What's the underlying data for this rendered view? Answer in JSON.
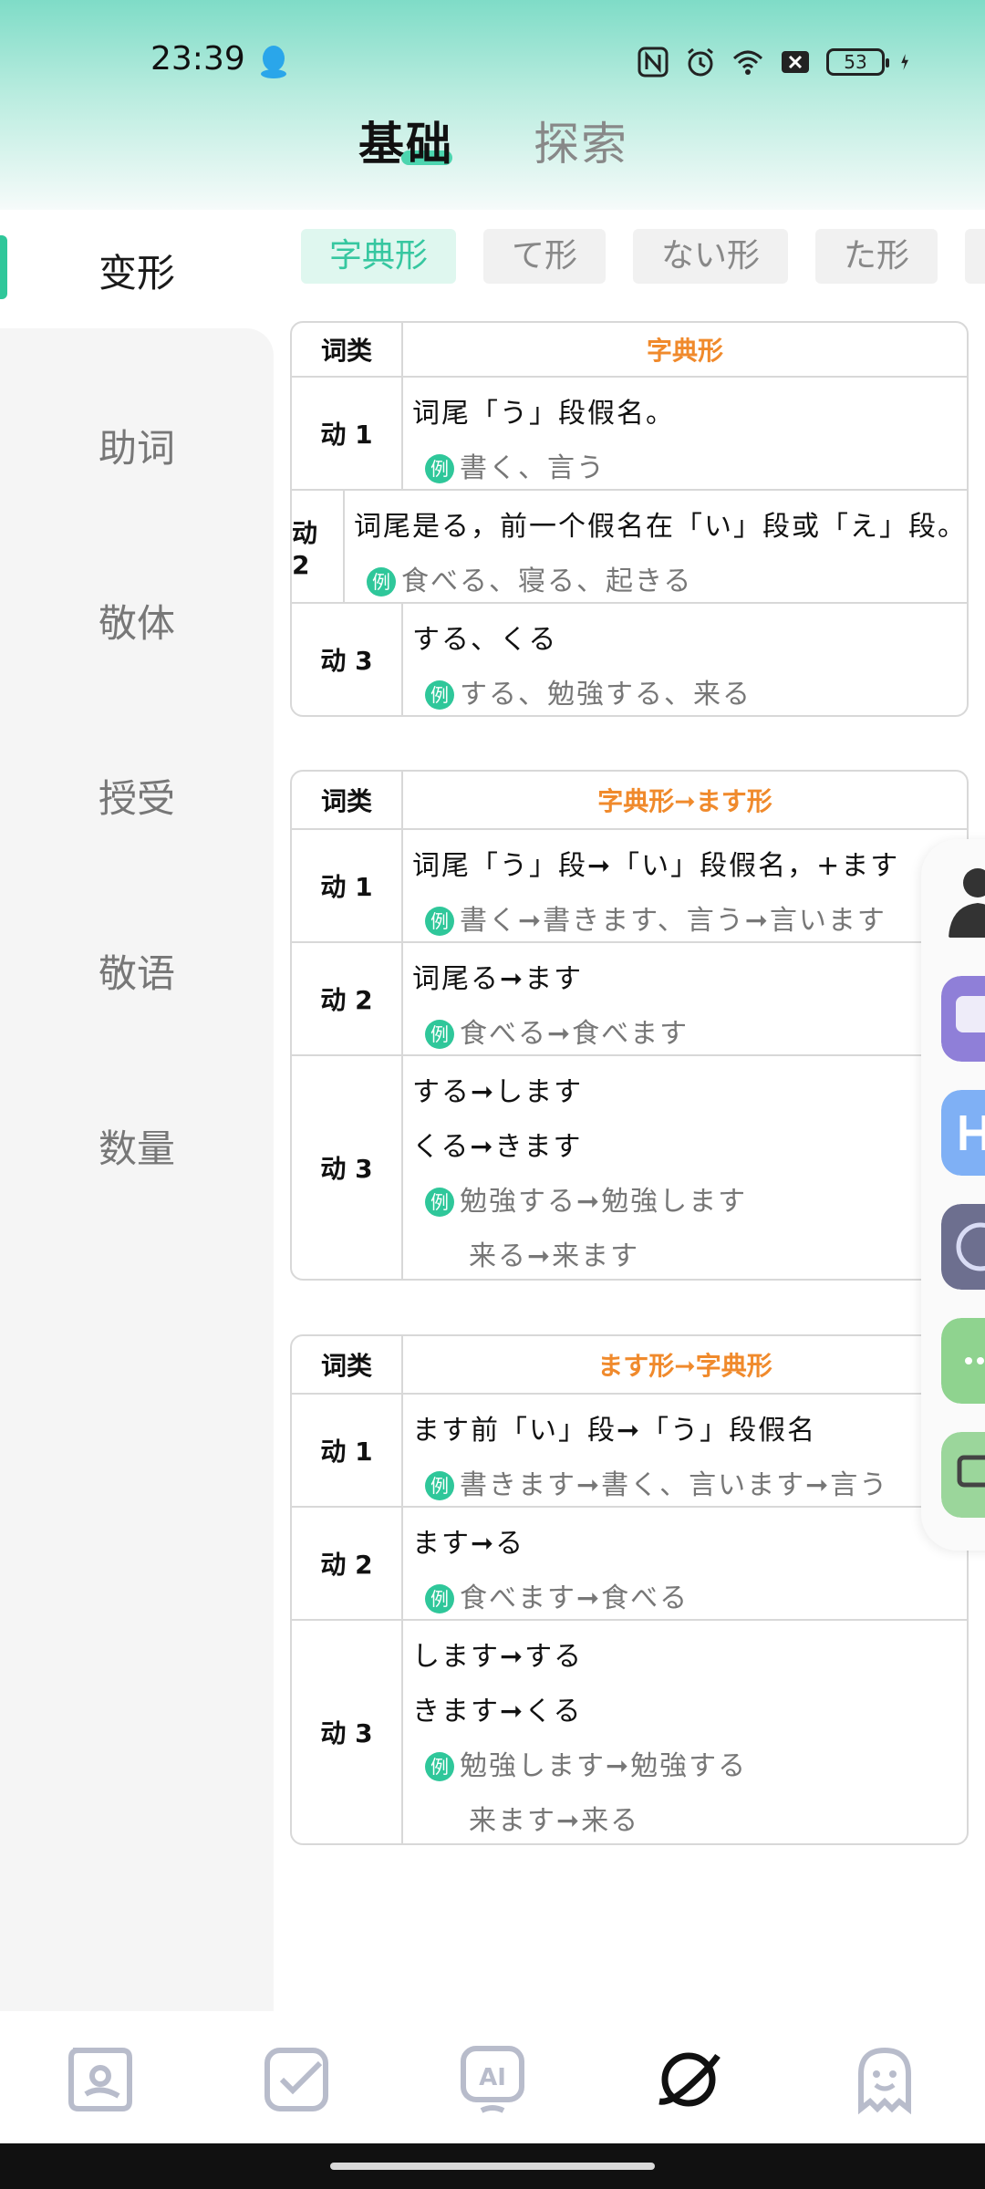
{
  "status_bar": {
    "time": "23:39",
    "battery": "53"
  },
  "top_tabs": {
    "basic": "基础",
    "explore": "探索"
  },
  "sidebar": {
    "items": [
      {
        "label": "变形",
        "active": true
      },
      {
        "label": "助词"
      },
      {
        "label": "敬体"
      },
      {
        "label": "授受"
      },
      {
        "label": "敬语"
      },
      {
        "label": "数量"
      }
    ]
  },
  "sub_tabs": [
    "字典形",
    "て形",
    "ない形",
    "た形"
  ],
  "example_badge": "例",
  "tables": [
    {
      "header": {
        "col1": "词类",
        "col2": "字典形"
      },
      "rows": [
        {
          "type": "动 1",
          "lines": [
            "词尾「う」段假名。"
          ],
          "examples": [
            "書く、言う"
          ]
        },
        {
          "type": "动 2",
          "lines": [
            "词尾是る，前一个假名在「い」段或「え」段。"
          ],
          "examples": [
            "食べる、寝る、起きる"
          ]
        },
        {
          "type": "动 3",
          "lines": [
            "する、くる"
          ],
          "examples": [
            "する、勉強する、来る"
          ]
        }
      ]
    },
    {
      "header": {
        "col1": "词类",
        "col2": "字典形➞ます形"
      },
      "rows": [
        {
          "type": "动 1",
          "lines": [
            "词尾「う」段➞「い」段假名，+ます"
          ],
          "examples": [
            "書く➞書きます、言う➞言います"
          ]
        },
        {
          "type": "动 2",
          "lines": [
            "词尾る➞ます"
          ],
          "examples": [
            "食べる➞食べます"
          ]
        },
        {
          "type": "动 3",
          "lines": [
            "する➞します",
            "くる➞きます"
          ],
          "examples": [
            "勉強する➞勉強します",
            "来る➞来ます"
          ]
        }
      ]
    },
    {
      "header": {
        "col1": "词类",
        "col2": "ます形➞字典形"
      },
      "rows": [
        {
          "type": "动 1",
          "lines": [
            "ます前「い」段➞「う」段假名"
          ],
          "examples": [
            "書きます➞書く、言います➞言う"
          ]
        },
        {
          "type": "动 2",
          "lines": [
            "ます➞る"
          ],
          "examples": [
            "食べます➞食べる"
          ]
        },
        {
          "type": "动 3",
          "lines": [
            "します➞する",
            "きます➞くる"
          ],
          "examples": [
            "勉強します➞勉強する",
            "来ます➞来る"
          ]
        }
      ]
    }
  ],
  "bottom_nav": [
    "study-icon",
    "checkin-icon",
    "ai-icon",
    "planet-icon",
    "ghost-icon"
  ],
  "colors": {
    "accent": "#2fc79a",
    "header_orange": "#f08a2c"
  }
}
